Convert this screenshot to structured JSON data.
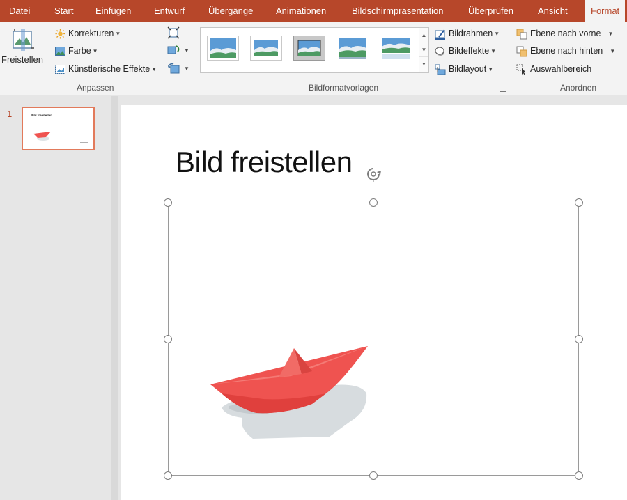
{
  "tabs": [
    "Datei",
    "Start",
    "Einfügen",
    "Entwurf",
    "Übergänge",
    "Animationen",
    "Bildschirmpräsentation",
    "Überprüfen",
    "Ansicht",
    "Format"
  ],
  "active_tab": "Format",
  "ribbon": {
    "freistellen": "Freistellen",
    "anpassen": {
      "label": "Anpassen",
      "korrekturen": "Korrekturen",
      "farbe": "Farbe",
      "kuenstlerische": "Künstlerische Effekte"
    },
    "bildformat": {
      "label": "Bildformatvorlagen",
      "bildrahmen": "Bildrahmen",
      "bildeffekte": "Bildeffekte",
      "bildlayout": "Bildlayout"
    },
    "anordnen": {
      "label": "Anordnen",
      "ebene_vorne": "Ebene nach vorne",
      "ebene_hinten": "Ebene nach hinten",
      "auswahlbereich": "Auswahlbereich"
    }
  },
  "slides_pane": {
    "number": "1",
    "thumb_title": "Bild freistellen"
  },
  "slide": {
    "title": "Bild freistellen"
  },
  "colors": {
    "accent": "#b7472a",
    "ribbon_bg": "#f3f3f3",
    "boat": "#ef5350",
    "selection": "#e27a5b"
  }
}
